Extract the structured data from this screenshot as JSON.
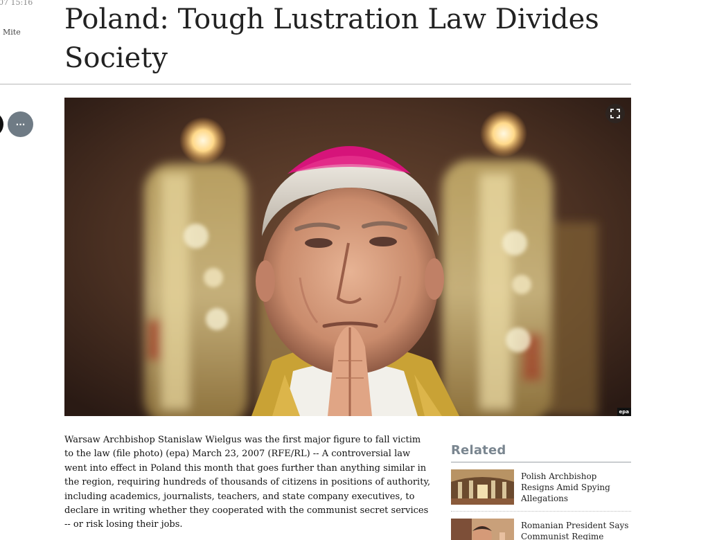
{
  "meta": {
    "timestamp": "07 15:16",
    "author": "Mite"
  },
  "share": {
    "more_label": "···"
  },
  "article": {
    "title": "Poland: Tough Lustration Law Divides Society",
    "photo_credit": "epa",
    "caption": "Warsaw Archbishop Stanislaw Wielgus was the first major figure to fall victim to the law (file photo) (epa) March 23, 2007 (RFE/RL) -- A controversial law went into effect in Poland this month that goes further than anything similar in the region, requiring hundreds of thousands of citizens in positions of authority, including academics, journalists, teachers, and state company executives, to declare in writing whether they cooperated with the communist secret services -- or risk losing their jobs."
  },
  "related": {
    "title": "Related",
    "items": [
      {
        "label": "Polish Archbishop Resigns Amid Spying Allegations"
      },
      {
        "label": "Romanian President Says Communist Regime"
      }
    ]
  },
  "colors": {
    "accent_gray": "#7a8690",
    "share_gray": "#6f7b85"
  },
  "icons": {
    "expand": "expand-icon",
    "more": "more-icon"
  }
}
